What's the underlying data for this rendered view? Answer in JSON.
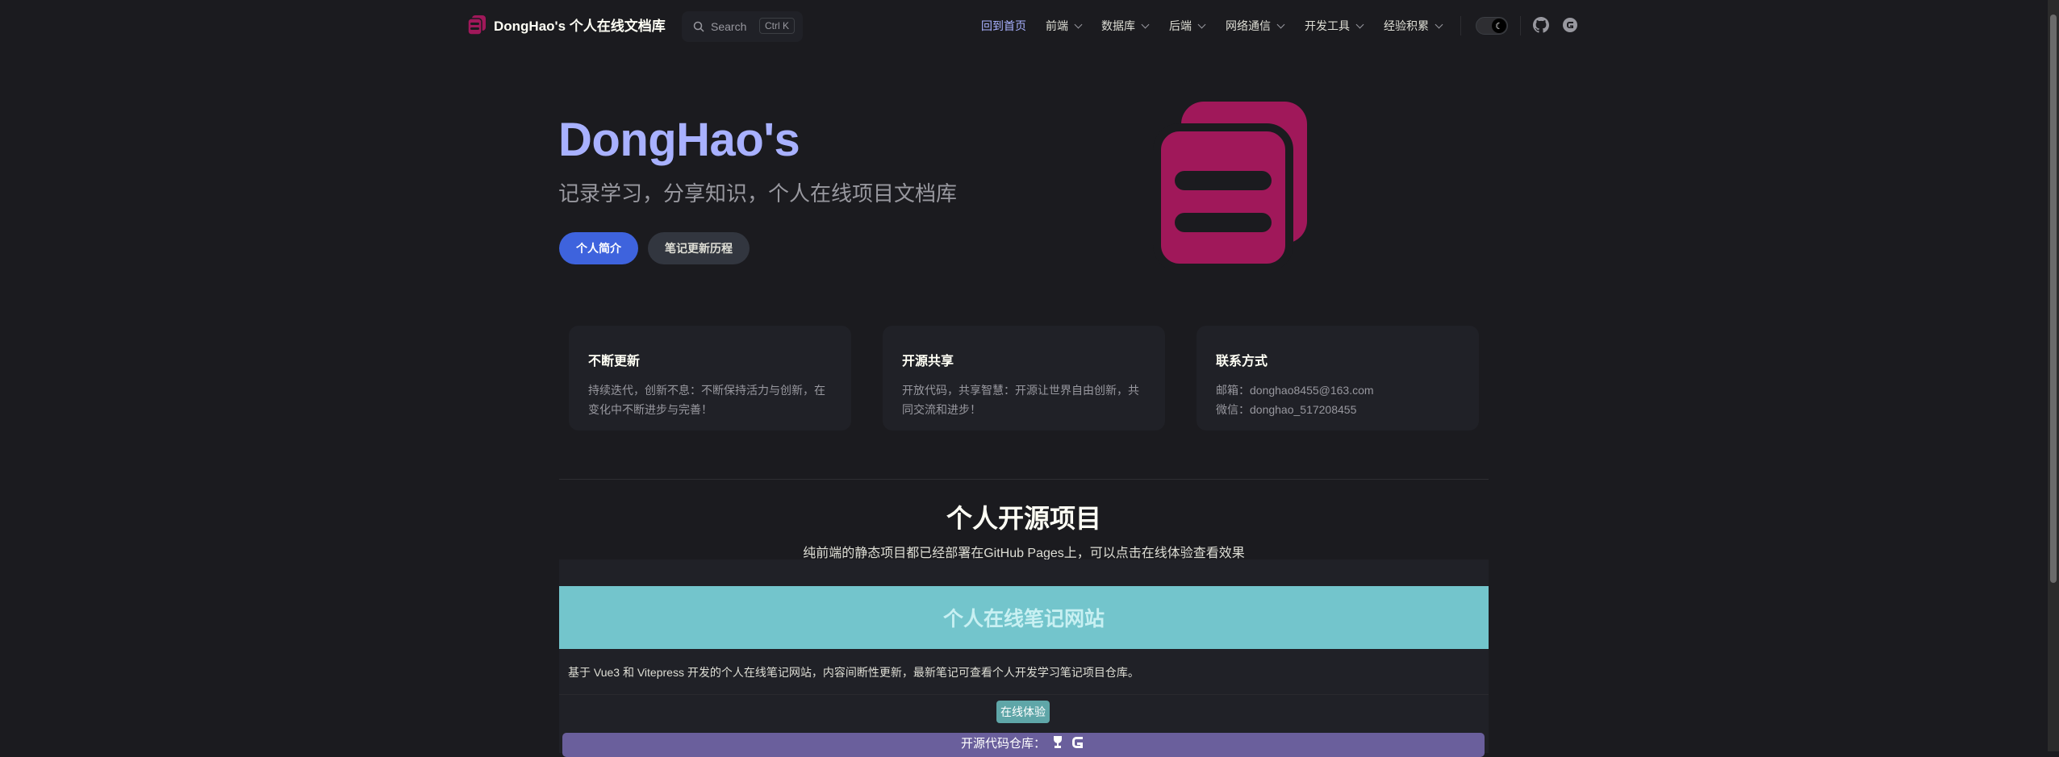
{
  "nav": {
    "brand": "DongHao's 个人在线文档库",
    "search_label": "Search",
    "search_shortcut": "Ctrl K",
    "items": [
      {
        "label": "回到首页",
        "active": true
      },
      {
        "label": "前端"
      },
      {
        "label": "数据库"
      },
      {
        "label": "后端"
      },
      {
        "label": "网络通信"
      },
      {
        "label": "开发工具"
      },
      {
        "label": "经验积累"
      }
    ],
    "icons": [
      "moon-icon",
      "github-icon",
      "gitee-icon"
    ]
  },
  "hero": {
    "name": "DongHao's",
    "tagline": "记录学习，分享知识，个人在线项目文档库",
    "actions": [
      {
        "label": "个人简介"
      },
      {
        "label": "笔记更新历程"
      }
    ]
  },
  "features": [
    {
      "title": "不断更新",
      "details": "持续迭代，创新不息：不断保持活力与创新，在变化中不断进步与完善！"
    },
    {
      "title": "开源共享",
      "details": "开放代码，共享智慧：开源让世界自由创新，共同交流和进步！"
    },
    {
      "title": "联系方式",
      "details_lines": [
        "邮箱：donghao8455@163.com",
        "微信：donghao_517208455"
      ]
    }
  ],
  "projects_section": {
    "title": "个人开源项目",
    "subtitle": "纯前端的静态项目都已经部署在GitHub Pages上，可以点击在线体验查看效果",
    "project": {
      "name": "个人在线笔记网站",
      "description": "基于 Vue3 和 Vitepress 开发的个人在线笔记网站，内容间断性更新，最新笔记可查看个人开发学习笔记项目仓库。",
      "demo_label": "在线体验",
      "repo_label": "开源代码仓库："
    }
  },
  "colors": {
    "background": "#1b1b1f",
    "brand": "#a8b1ff",
    "primary_button": "#3e63dd",
    "logo": "#a0185a",
    "card_header": "#73c5cc",
    "repo_bar": "#6a5f9c"
  }
}
